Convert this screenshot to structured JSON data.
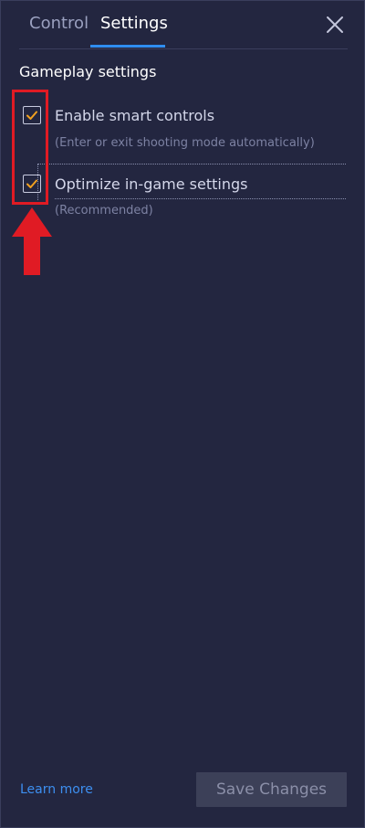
{
  "tabs": {
    "control": "Control",
    "settings": "Settings",
    "active": "settings"
  },
  "section": {
    "title": "Gameplay settings"
  },
  "options": [
    {
      "label": "Enable smart controls",
      "description": "(Enter or exit shooting mode automatically)",
      "checked": true
    },
    {
      "label": "Optimize in-game settings",
      "description": "(Recommended)",
      "checked": true
    }
  ],
  "footer": {
    "learn_more": "Learn more",
    "save_label": "Save Changes"
  },
  "colors": {
    "background": "#232640",
    "accent": "#2f8df0",
    "check": "#f0a020",
    "annotation": "#e01b24"
  },
  "icons": {
    "close": "close-icon",
    "check": "checkmark-icon",
    "arrow": "arrow-up-icon"
  }
}
